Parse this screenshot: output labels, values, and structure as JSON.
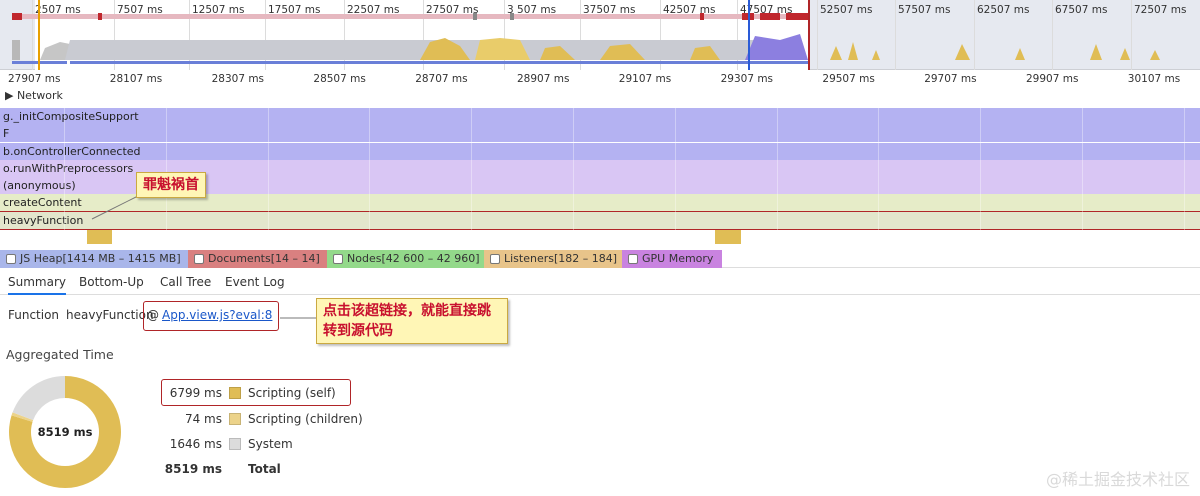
{
  "overview": {
    "tick_labels": [
      "2507 ms",
      "7507 ms",
      "12507 ms",
      "17507 ms",
      "22507 ms",
      "27507 ms",
      "3 507 ms",
      "37507 ms",
      "42507 ms",
      "47507 ms",
      "52507 ms",
      "57507 ms",
      "62507 ms",
      "67507 ms",
      "72507 ms"
    ]
  },
  "ruler": {
    "labels": [
      "27907 ms",
      "28107 ms",
      "28307 ms",
      "28507 ms",
      "28707 ms",
      "28907 ms",
      "29107 ms",
      "29307 ms",
      "29507 ms",
      "29707 ms",
      "29907 ms",
      "30107 ms"
    ]
  },
  "network": {
    "label": "▶ Network"
  },
  "flame": {
    "rows": [
      "g._initCompositeSupport",
      "F",
      "b.onControllerConnected",
      "o.runWithPreprocessors",
      "(anonymous)",
      "createContent",
      "heavyFunction"
    ]
  },
  "callouts": {
    "culprit": "罪魁祸首",
    "link_hint": "点击该超链接，就能直接跳转到源代码"
  },
  "counters": [
    {
      "label": "JS Heap[1414 MB – 1415 MB]",
      "color": "#a9b6ea"
    },
    {
      "label": "Documents[14 – 14]",
      "color": "#d98080"
    },
    {
      "label": "Nodes[42 600 – 42 960]",
      "color": "#93d98a"
    },
    {
      "label": "Listeners[182 – 184]",
      "color": "#e8c48a"
    },
    {
      "label": "GPU Memory",
      "color": "#c983e0"
    }
  ],
  "tabs": [
    "Summary",
    "Bottom-Up",
    "Call Tree",
    "Event Log"
  ],
  "summary": {
    "function_label": "Function",
    "function_name": "heavyFunction",
    "at": "@",
    "link": "App.view.js?eval:8",
    "aggregated_title": "Aggregated Time",
    "total_center": "8519 ms",
    "legend": [
      {
        "value": "6799 ms",
        "label": "Scripting (self)",
        "color": "#e0bd55",
        "bold": false
      },
      {
        "value": "74 ms",
        "label": "Scripting (children)",
        "color": "#ecd38a",
        "bold": false
      },
      {
        "value": "1646 ms",
        "label": "System",
        "color": "#dcdcdc",
        "bold": false
      },
      {
        "value": "8519 ms",
        "label": "Total",
        "color": "",
        "bold": true
      }
    ],
    "donut_fractions": [
      0.798,
      0.009,
      0.193
    ]
  },
  "watermark": "@稀土掘金技术社区",
  "colors": {
    "scripting_self": "#e0bd55",
    "scripting_children": "#ecd38a",
    "system": "#dcdcdc",
    "highlight_red": "#b02528",
    "link_blue": "#1a57c9"
  }
}
